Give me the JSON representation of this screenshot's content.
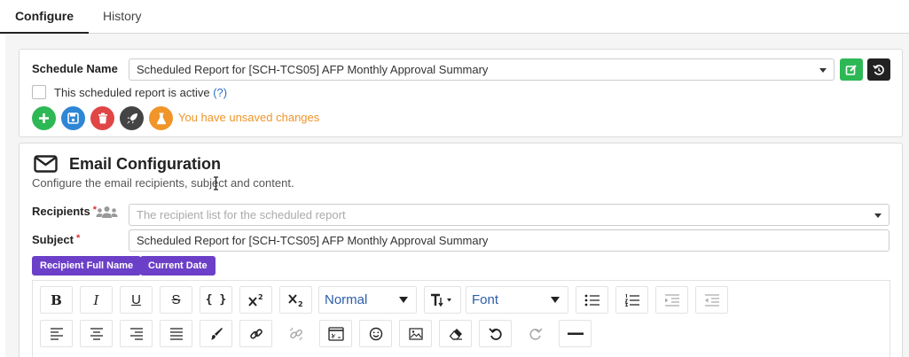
{
  "tabs": [
    {
      "label": "Configure",
      "active": true
    },
    {
      "label": "History",
      "active": false
    }
  ],
  "schedule": {
    "name_label": "Schedule Name",
    "name_value": "Scheduled Report for [SCH-TCS05] AFP Monthly Approval Summary",
    "active_label": "This scheduled report is active",
    "active_checked": false,
    "help_text": "(?)",
    "unsaved_text": "You have unsaved changes"
  },
  "email": {
    "title": "Email Configuration",
    "description": "Configure the email recipients, subject and content.",
    "recipients_label": "Recipients",
    "recipients_placeholder": "The recipient list for the scheduled report",
    "subject_label": "Subject",
    "subject_value": "Scheduled Report for [SCH-TCS05] AFP Monthly Approval Summary",
    "required_mark": "*",
    "placeholder_chips": [
      "Recipient Full Name",
      "Current Date"
    ]
  },
  "editor": {
    "format_value": "Normal",
    "font_value": "Font",
    "bold": "B",
    "italic": "I",
    "underline": "U",
    "strike": "S",
    "code": "{ }"
  },
  "colors": {
    "green": "#2db855",
    "blue": "#2f86d6",
    "red": "#e04646",
    "dark": "#444444",
    "orange": "#f0952a",
    "purple": "#6b3fc8"
  }
}
